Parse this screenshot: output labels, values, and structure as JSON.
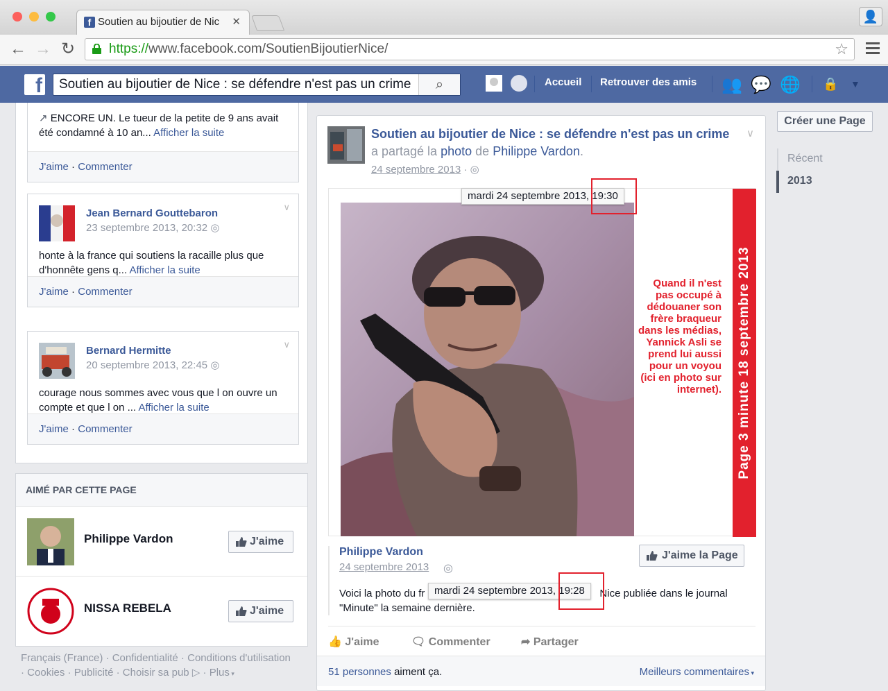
{
  "browser": {
    "tab_title": "Soutien au bijoutier de Nic",
    "url_https": "https://",
    "url_rest": "www.facebook.com/SoutienBijoutierNice/"
  },
  "fb": {
    "search_value": "Soutien au bijoutier de Nice : se défendre n'est pas un crime",
    "nav_home": "Accueil",
    "nav_friends": "Retrouver des amis"
  },
  "left": {
    "post1": {
      "body_text": "ENCORE UN. Le tueur de la petite de 9 ans avait été condamné à 10 an... ",
      "more": "Afficher la suite",
      "like": "J'aime",
      "comment": "Commenter"
    },
    "post2": {
      "name": "Jean Bernard Gouttebaron",
      "date": "23 septembre 2013, 20:32",
      "body_text": "honte à la france qui soutiens la racaille plus que d'honnête gens q... ",
      "more": "Afficher la suite",
      "like": "J'aime",
      "comment": "Commenter"
    },
    "post3": {
      "name": "Bernard Hermitte",
      "date": "20 septembre 2013, 22:45",
      "body_text": "courage nous sommes avec vous que l on ouvre un compte et que l on ... ",
      "more": "Afficher la suite",
      "like": "J'aime",
      "comment": "Commenter"
    },
    "liked_by": {
      "header": "AIMÉ PAR CETTE PAGE",
      "pages": [
        {
          "name": "Philippe Vardon",
          "button": "J'aime"
        },
        {
          "name": "NISSA REBELA",
          "button": "J'aime"
        }
      ]
    },
    "footer": {
      "links": [
        "Français (France)",
        "Confidentialité",
        "Conditions d'utilisation",
        "Cookies",
        "Publicité",
        "Choisir sa pub",
        "Plus"
      ]
    }
  },
  "main": {
    "page_name": "Soutien au bijoutier de Nice : se défendre n'est pas un crime",
    "shared_text": "a partagé la",
    "photo_word": "photo",
    "de_word": "de",
    "source_name": "Philippe Vardon",
    "date": "24 septembre 2013",
    "tooltip1_date": "mardi 24 septembre 2013, ",
    "tooltip1_time": "19:30",
    "photo_sidebar": "Page 3   minute   18 septembre 2013",
    "photo_caption": "Quand il n'est pas occupé à dédouaner son frère braqueur dans les médias, Yannick Asli se prend lui aussi pour un voyou (ici en photo sur internet).",
    "quote": {
      "name": "Philippe Vardon",
      "date": "24 septembre 2013",
      "like_page": "J'aime la Page",
      "text_start": "Voici la photo du fr",
      "text_end": "Nice publiée dans le journal \"Minute\" la semaine dernière.",
      "tooltip2_date": "mardi 24 septembre 2013, ",
      "tooltip2_time": "19:28"
    },
    "actions": {
      "like": "J'aime",
      "comment": "Commenter",
      "share": "Partager"
    },
    "likes_count": "51 personnes",
    "likes_suffix": " aiment ça.",
    "best_comments": "Meilleurs commentaires"
  },
  "right": {
    "create_page": "Créer une Page",
    "timeline": [
      "Récent",
      "2013"
    ]
  },
  "colors": {
    "fb_blue": "#4e69a2",
    "link": "#3b5998",
    "highlight": "#e2212d"
  }
}
